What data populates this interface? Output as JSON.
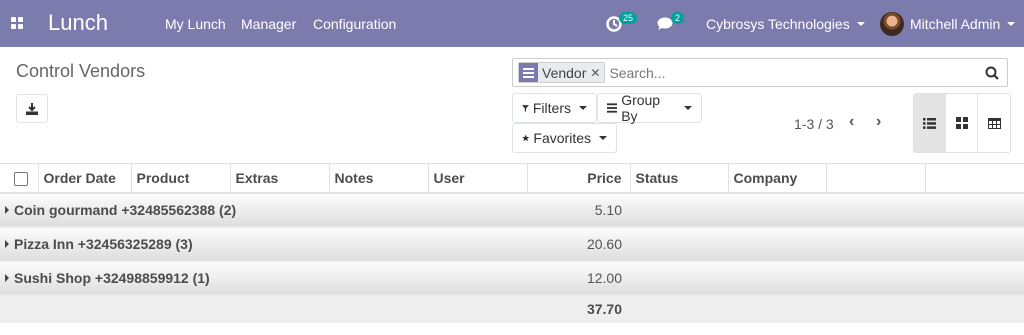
{
  "topbar": {
    "app_name": "Lunch",
    "menu": [
      "My Lunch",
      "Manager",
      "Configuration"
    ],
    "activity_count": "25",
    "messages_count": "2",
    "company": "Cybrosys Technologies",
    "user": "Mitchell Admin"
  },
  "control_panel": {
    "breadcrumb": "Control Vendors",
    "facet_label": "Vendor",
    "search_placeholder": "Search...",
    "filters_label": "Filters",
    "groupby_label": "Group By",
    "favorites_label": "Favorites",
    "pager": "1-3 / 3"
  },
  "table": {
    "columns": [
      "Order Date",
      "Product",
      "Extras",
      "Notes",
      "User",
      "Price",
      "Status",
      "Company"
    ],
    "groups": [
      {
        "label": "Coin gourmand +32485562388 (2)",
        "price": "5.10"
      },
      {
        "label": "Pizza Inn +32456325289 (3)",
        "price": "20.60"
      },
      {
        "label": "Sushi Shop +32498859912 (1)",
        "price": "12.00"
      }
    ],
    "total": "37.70"
  },
  "colors": {
    "brand": "#7c7bad",
    "badge": "#00a09d"
  },
  "icons": [
    "apps-icon",
    "activity-icon",
    "chat-icon",
    "download-icon",
    "search-icon",
    "filter-icon",
    "groupby-icon",
    "star-icon",
    "list-view-icon",
    "kanban-view-icon",
    "pivot-view-icon"
  ]
}
